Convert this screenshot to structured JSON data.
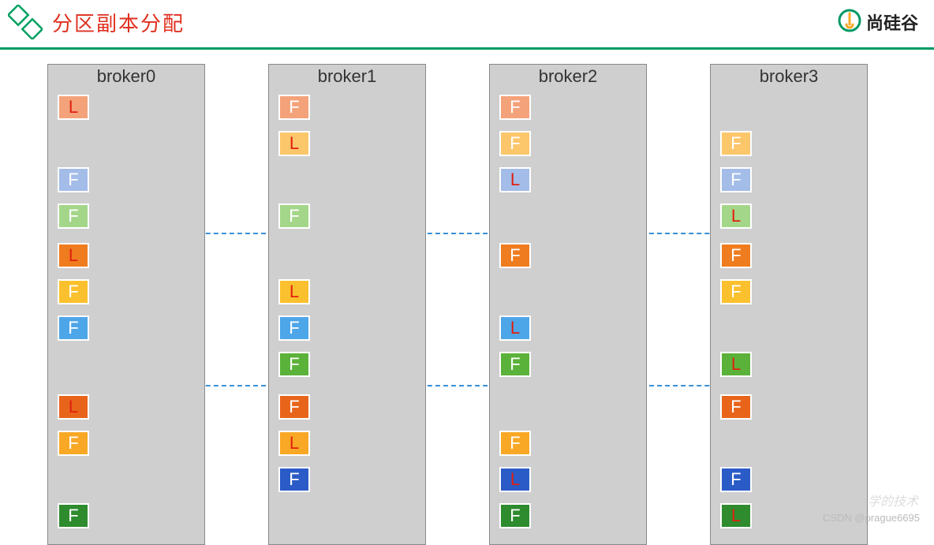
{
  "header": {
    "title": "分区副本分配",
    "brand": "尚硅谷"
  },
  "brokers": [
    {
      "id": "b0",
      "title": "broker0"
    },
    {
      "id": "b1",
      "title": "broker1"
    },
    {
      "id": "b2",
      "title": "broker2"
    },
    {
      "id": "b3",
      "title": "broker3"
    }
  ],
  "cells": {
    "b0_r1": "L",
    "b1_r1": "F",
    "b2_r1": "F",
    "b1_r2": "L",
    "b2_r2": "F",
    "b3_r2": "F",
    "b0_r3": "F",
    "b2_r3": "L",
    "b3_r3": "F",
    "b0_r4": "F",
    "b1_r4": "F",
    "b3_r4": "L",
    "b0_r5": "L",
    "b2_r5": "F",
    "b3_r5": "F",
    "b0_r6": "F",
    "b1_r6": "L",
    "b3_r6": "F",
    "b0_r7": "F",
    "b1_r7": "F",
    "b2_r7": "L",
    "b1_r8": "F",
    "b2_r8": "F",
    "b3_r8": "L",
    "b0_r9": "L",
    "b1_r9": "F",
    "b3_r9": "F",
    "b0_r10": "F",
    "b1_r10": "L",
    "b2_r10": "F",
    "b1_r11": "F",
    "b2_r11": "L",
    "b3_r11": "F",
    "b0_r12": "F",
    "b2_r12": "F",
    "b3_r12": "L"
  },
  "watermark": "CSDN @prague6695",
  "watermark2": "学的技术"
}
